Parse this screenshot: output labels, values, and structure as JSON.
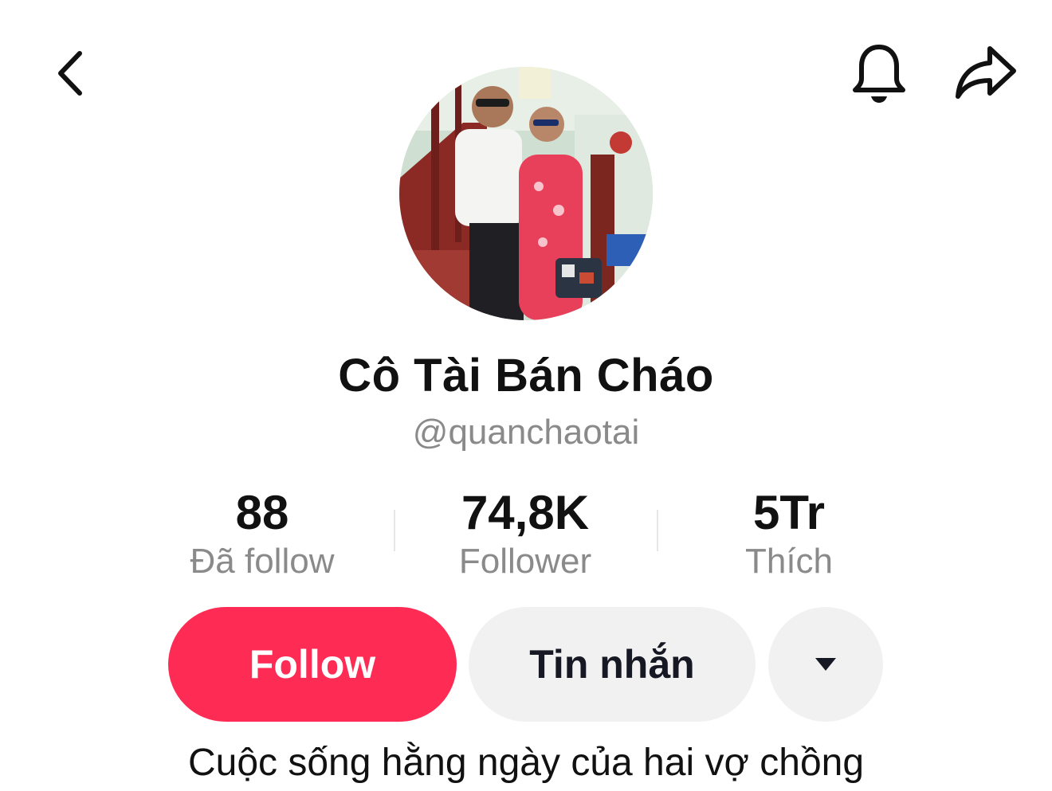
{
  "header": {
    "back_icon": "chevron-left-icon",
    "notification_icon": "bell-icon",
    "share_icon": "share-arrow-icon"
  },
  "profile": {
    "display_name": "Cô Tài Bán Cháo",
    "username": "@quanchaotai",
    "bio": "Cuộc sống hằng ngày của hai vợ chồng"
  },
  "stats": [
    {
      "value": "88",
      "label": "Đã follow"
    },
    {
      "value": "74,8K",
      "label": "Follower"
    },
    {
      "value": "5Tr",
      "label": "Thích"
    }
  ],
  "actions": {
    "follow_label": "Follow",
    "message_label": "Tin nhắn",
    "more_icon": "caret-down-icon"
  },
  "colors": {
    "follow_button": "#fe2c55",
    "secondary_button": "#f1f1f2",
    "muted_text": "#8a8a8a"
  }
}
